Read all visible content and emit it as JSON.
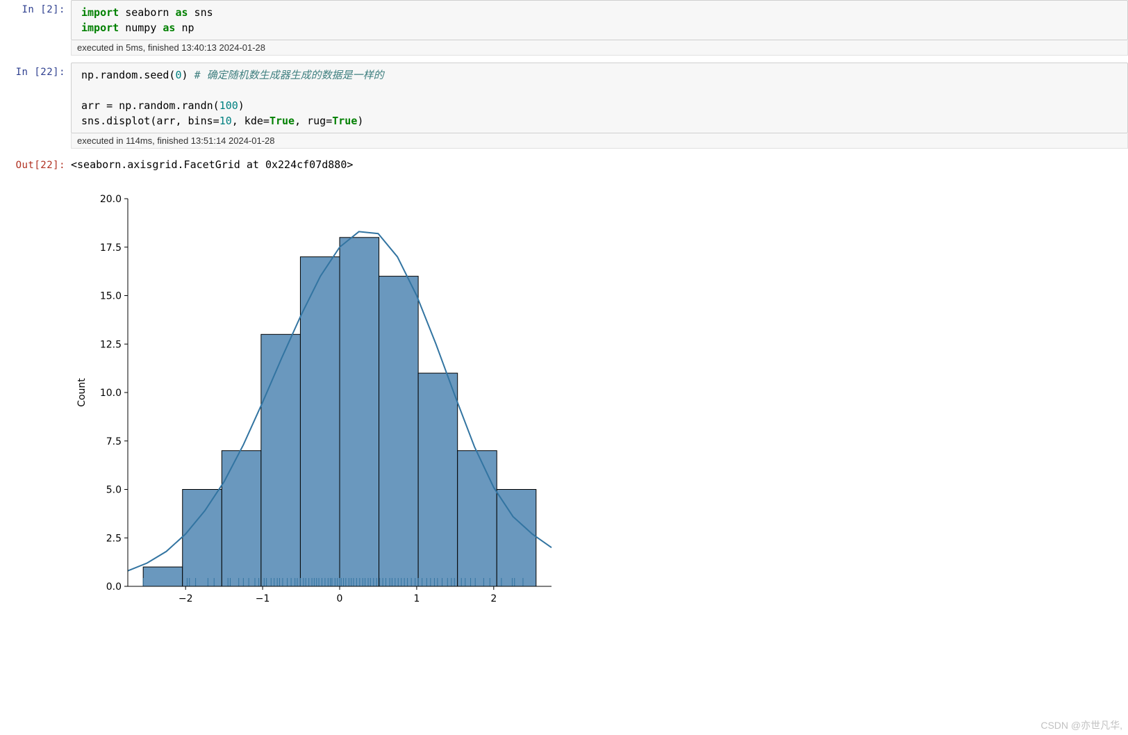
{
  "cells": {
    "c1": {
      "in_prompt": "In  [2]:",
      "exec_label": "executed in 5ms, finished 13:40:13 2024-01-28",
      "code": {
        "l1_kw1": "import",
        "l1_mod": " seaborn ",
        "l1_kw2": "as",
        "l1_alias": " sns",
        "l2_kw1": "import",
        "l2_mod": " numpy ",
        "l2_kw2": "as",
        "l2_alias": " np"
      }
    },
    "c2": {
      "in_prompt": "In  [22]:",
      "exec_label": "executed in 114ms, finished 13:51:14 2024-01-28",
      "code": {
        "l1_a": "np.random.seed(",
        "l1_num": "0",
        "l1_b": ") ",
        "l1_cmt": "# 确定随机数生成器生成的数据是一样的",
        "l3_a": "arr = np.random.randn(",
        "l3_num": "100",
        "l3_b": ")",
        "l4_a": "sns.displot(arr, bins=",
        "l4_num": "10",
        "l4_b": ", kde=",
        "l4_true1": "True",
        "l4_c": ", rug=",
        "l4_true2": "True",
        "l4_d": ")"
      }
    },
    "out": {
      "prompt": "Out[22]:",
      "text": "<seaborn.axisgrid.FacetGrid at 0x224cf07d880>"
    }
  },
  "watermark": "CSDN @亦世凡华,",
  "chart_data": {
    "type": "bar",
    "title": "",
    "xlabel": "",
    "ylabel": "Count",
    "xlim": [
      -2.75,
      2.75
    ],
    "ylim": [
      0,
      20
    ],
    "xticks": [
      -2,
      -1,
      0,
      1,
      2
    ],
    "yticks": [
      0.0,
      2.5,
      5.0,
      7.5,
      10.0,
      12.5,
      15.0,
      17.5,
      20.0
    ],
    "bin_edges": [
      -2.55,
      -2.04,
      -1.53,
      -1.02,
      -0.51,
      0.0,
      0.51,
      1.02,
      1.53,
      2.04,
      2.55
    ],
    "values": [
      1,
      5,
      7,
      13,
      17,
      18,
      16,
      11,
      7,
      5
    ],
    "series": [
      {
        "name": "kde",
        "type": "line",
        "x": [
          -2.75,
          -2.5,
          -2.25,
          -2.0,
          -1.75,
          -1.5,
          -1.25,
          -1.0,
          -0.75,
          -0.5,
          -0.25,
          0.0,
          0.25,
          0.5,
          0.75,
          1.0,
          1.25,
          1.5,
          1.75,
          2.0,
          2.25,
          2.5,
          2.75
        ],
        "y": [
          0.8,
          1.2,
          1.8,
          2.7,
          3.9,
          5.4,
          7.3,
          9.5,
          11.8,
          14.0,
          16.0,
          17.5,
          18.3,
          18.2,
          17.0,
          15.0,
          12.5,
          9.8,
          7.2,
          5.1,
          3.6,
          2.7,
          2.0
        ]
      }
    ],
    "rug_x": [
      -2.55,
      -1.98,
      -1.95,
      -1.87,
      -1.71,
      -1.63,
      -1.45,
      -1.42,
      -1.31,
      -1.25,
      -1.18,
      -1.1,
      -1.05,
      -0.98,
      -0.95,
      -0.89,
      -0.85,
      -0.81,
      -0.78,
      -0.74,
      -0.68,
      -0.63,
      -0.58,
      -0.55,
      -0.51,
      -0.47,
      -0.44,
      -0.4,
      -0.36,
      -0.33,
      -0.3,
      -0.27,
      -0.23,
      -0.19,
      -0.15,
      -0.12,
      -0.1,
      -0.06,
      -0.03,
      0.0,
      0.02,
      0.05,
      0.08,
      0.12,
      0.15,
      0.18,
      0.22,
      0.26,
      0.3,
      0.33,
      0.37,
      0.4,
      0.44,
      0.48,
      0.52,
      0.56,
      0.6,
      0.65,
      0.68,
      0.72,
      0.76,
      0.8,
      0.84,
      0.88,
      0.93,
      0.98,
      1.02,
      1.07,
      1.13,
      1.18,
      1.23,
      1.27,
      1.33,
      1.4,
      1.45,
      1.49,
      1.58,
      1.63,
      1.7,
      1.76,
      1.87,
      1.95,
      2.1,
      2.24,
      2.27,
      2.38
    ],
    "colors": {
      "bar_fill": "#6a98be",
      "bar_stroke": "#000000",
      "kde_stroke": "#3274a1",
      "rug_stroke": "#3274a1",
      "axis": "#000000"
    }
  }
}
